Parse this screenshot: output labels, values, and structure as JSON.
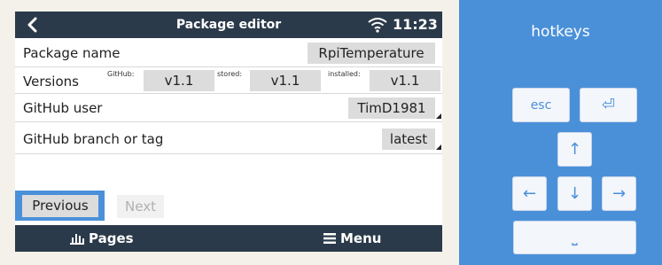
{
  "header": {
    "title": "Package editor",
    "time": "11:23"
  },
  "rows": {
    "package_name": {
      "label": "Package name",
      "value": "RpiTemperature"
    },
    "versions": {
      "label": "Versions",
      "github_label": "GitHub:",
      "github_value": "v1.1",
      "stored_label": "stored:",
      "stored_value": "v1.1",
      "installed_label": "installed:",
      "installed_value": "v1.1"
    },
    "github_user": {
      "label": "GitHub user",
      "value": "TimD1981"
    },
    "github_branch": {
      "label": "GitHub branch or tag",
      "value": "latest"
    }
  },
  "buttons": {
    "previous": "Previous",
    "next": "Next"
  },
  "footer": {
    "pages": "Pages",
    "menu": "Menu"
  },
  "hotkeys": {
    "title": "hotkeys",
    "esc": "esc",
    "enter": "⏎",
    "up": "↑",
    "left": "←",
    "down": "↓",
    "right": "→",
    "space": "⎵"
  },
  "colors": {
    "header_bg": "#2b3a4a",
    "accent": "#4a90d9",
    "field_bg": "#dcdcdc"
  }
}
